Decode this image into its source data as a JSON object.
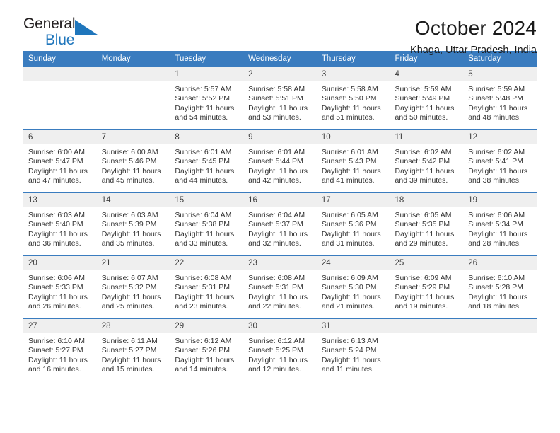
{
  "brand": {
    "name_top": "General",
    "name_bottom": "Blue",
    "triangle_color": "#1f76bc"
  },
  "header": {
    "title": "October 2024",
    "subtitle": "Khaga, Uttar Pradesh, India"
  },
  "calendar": {
    "header_bg": "#3a7cbf",
    "daycell_header_bg": "#efefef",
    "weekdays": [
      "Sunday",
      "Monday",
      "Tuesday",
      "Wednesday",
      "Thursday",
      "Friday",
      "Saturday"
    ],
    "labels": {
      "sunrise": "Sunrise:",
      "sunset": "Sunset:",
      "daylight": "Daylight:"
    },
    "weeks": [
      [
        {
          "day": ""
        },
        {
          "day": ""
        },
        {
          "day": "1",
          "sunrise": "Sunrise: 5:57 AM",
          "sunset": "Sunset: 5:52 PM",
          "daylight_1": "Daylight: 11 hours",
          "daylight_2": "and 54 minutes."
        },
        {
          "day": "2",
          "sunrise": "Sunrise: 5:58 AM",
          "sunset": "Sunset: 5:51 PM",
          "daylight_1": "Daylight: 11 hours",
          "daylight_2": "and 53 minutes."
        },
        {
          "day": "3",
          "sunrise": "Sunrise: 5:58 AM",
          "sunset": "Sunset: 5:50 PM",
          "daylight_1": "Daylight: 11 hours",
          "daylight_2": "and 51 minutes."
        },
        {
          "day": "4",
          "sunrise": "Sunrise: 5:59 AM",
          "sunset": "Sunset: 5:49 PM",
          "daylight_1": "Daylight: 11 hours",
          "daylight_2": "and 50 minutes."
        },
        {
          "day": "5",
          "sunrise": "Sunrise: 5:59 AM",
          "sunset": "Sunset: 5:48 PM",
          "daylight_1": "Daylight: 11 hours",
          "daylight_2": "and 48 minutes."
        }
      ],
      [
        {
          "day": "6",
          "sunrise": "Sunrise: 6:00 AM",
          "sunset": "Sunset: 5:47 PM",
          "daylight_1": "Daylight: 11 hours",
          "daylight_2": "and 47 minutes."
        },
        {
          "day": "7",
          "sunrise": "Sunrise: 6:00 AM",
          "sunset": "Sunset: 5:46 PM",
          "daylight_1": "Daylight: 11 hours",
          "daylight_2": "and 45 minutes."
        },
        {
          "day": "8",
          "sunrise": "Sunrise: 6:01 AM",
          "sunset": "Sunset: 5:45 PM",
          "daylight_1": "Daylight: 11 hours",
          "daylight_2": "and 44 minutes."
        },
        {
          "day": "9",
          "sunrise": "Sunrise: 6:01 AM",
          "sunset": "Sunset: 5:44 PM",
          "daylight_1": "Daylight: 11 hours",
          "daylight_2": "and 42 minutes."
        },
        {
          "day": "10",
          "sunrise": "Sunrise: 6:01 AM",
          "sunset": "Sunset: 5:43 PM",
          "daylight_1": "Daylight: 11 hours",
          "daylight_2": "and 41 minutes."
        },
        {
          "day": "11",
          "sunrise": "Sunrise: 6:02 AM",
          "sunset": "Sunset: 5:42 PM",
          "daylight_1": "Daylight: 11 hours",
          "daylight_2": "and 39 minutes."
        },
        {
          "day": "12",
          "sunrise": "Sunrise: 6:02 AM",
          "sunset": "Sunset: 5:41 PM",
          "daylight_1": "Daylight: 11 hours",
          "daylight_2": "and 38 minutes."
        }
      ],
      [
        {
          "day": "13",
          "sunrise": "Sunrise: 6:03 AM",
          "sunset": "Sunset: 5:40 PM",
          "daylight_1": "Daylight: 11 hours",
          "daylight_2": "and 36 minutes."
        },
        {
          "day": "14",
          "sunrise": "Sunrise: 6:03 AM",
          "sunset": "Sunset: 5:39 PM",
          "daylight_1": "Daylight: 11 hours",
          "daylight_2": "and 35 minutes."
        },
        {
          "day": "15",
          "sunrise": "Sunrise: 6:04 AM",
          "sunset": "Sunset: 5:38 PM",
          "daylight_1": "Daylight: 11 hours",
          "daylight_2": "and 33 minutes."
        },
        {
          "day": "16",
          "sunrise": "Sunrise: 6:04 AM",
          "sunset": "Sunset: 5:37 PM",
          "daylight_1": "Daylight: 11 hours",
          "daylight_2": "and 32 minutes."
        },
        {
          "day": "17",
          "sunrise": "Sunrise: 6:05 AM",
          "sunset": "Sunset: 5:36 PM",
          "daylight_1": "Daylight: 11 hours",
          "daylight_2": "and 31 minutes."
        },
        {
          "day": "18",
          "sunrise": "Sunrise: 6:05 AM",
          "sunset": "Sunset: 5:35 PM",
          "daylight_1": "Daylight: 11 hours",
          "daylight_2": "and 29 minutes."
        },
        {
          "day": "19",
          "sunrise": "Sunrise: 6:06 AM",
          "sunset": "Sunset: 5:34 PM",
          "daylight_1": "Daylight: 11 hours",
          "daylight_2": "and 28 minutes."
        }
      ],
      [
        {
          "day": "20",
          "sunrise": "Sunrise: 6:06 AM",
          "sunset": "Sunset: 5:33 PM",
          "daylight_1": "Daylight: 11 hours",
          "daylight_2": "and 26 minutes."
        },
        {
          "day": "21",
          "sunrise": "Sunrise: 6:07 AM",
          "sunset": "Sunset: 5:32 PM",
          "daylight_1": "Daylight: 11 hours",
          "daylight_2": "and 25 minutes."
        },
        {
          "day": "22",
          "sunrise": "Sunrise: 6:08 AM",
          "sunset": "Sunset: 5:31 PM",
          "daylight_1": "Daylight: 11 hours",
          "daylight_2": "and 23 minutes."
        },
        {
          "day": "23",
          "sunrise": "Sunrise: 6:08 AM",
          "sunset": "Sunset: 5:31 PM",
          "daylight_1": "Daylight: 11 hours",
          "daylight_2": "and 22 minutes."
        },
        {
          "day": "24",
          "sunrise": "Sunrise: 6:09 AM",
          "sunset": "Sunset: 5:30 PM",
          "daylight_1": "Daylight: 11 hours",
          "daylight_2": "and 21 minutes."
        },
        {
          "day": "25",
          "sunrise": "Sunrise: 6:09 AM",
          "sunset": "Sunset: 5:29 PM",
          "daylight_1": "Daylight: 11 hours",
          "daylight_2": "and 19 minutes."
        },
        {
          "day": "26",
          "sunrise": "Sunrise: 6:10 AM",
          "sunset": "Sunset: 5:28 PM",
          "daylight_1": "Daylight: 11 hours",
          "daylight_2": "and 18 minutes."
        }
      ],
      [
        {
          "day": "27",
          "sunrise": "Sunrise: 6:10 AM",
          "sunset": "Sunset: 5:27 PM",
          "daylight_1": "Daylight: 11 hours",
          "daylight_2": "and 16 minutes."
        },
        {
          "day": "28",
          "sunrise": "Sunrise: 6:11 AM",
          "sunset": "Sunset: 5:27 PM",
          "daylight_1": "Daylight: 11 hours",
          "daylight_2": "and 15 minutes."
        },
        {
          "day": "29",
          "sunrise": "Sunrise: 6:12 AM",
          "sunset": "Sunset: 5:26 PM",
          "daylight_1": "Daylight: 11 hours",
          "daylight_2": "and 14 minutes."
        },
        {
          "day": "30",
          "sunrise": "Sunrise: 6:12 AM",
          "sunset": "Sunset: 5:25 PM",
          "daylight_1": "Daylight: 11 hours",
          "daylight_2": "and 12 minutes."
        },
        {
          "day": "31",
          "sunrise": "Sunrise: 6:13 AM",
          "sunset": "Sunset: 5:24 PM",
          "daylight_1": "Daylight: 11 hours",
          "daylight_2": "and 11 minutes."
        },
        {
          "day": ""
        },
        {
          "day": ""
        }
      ]
    ]
  }
}
